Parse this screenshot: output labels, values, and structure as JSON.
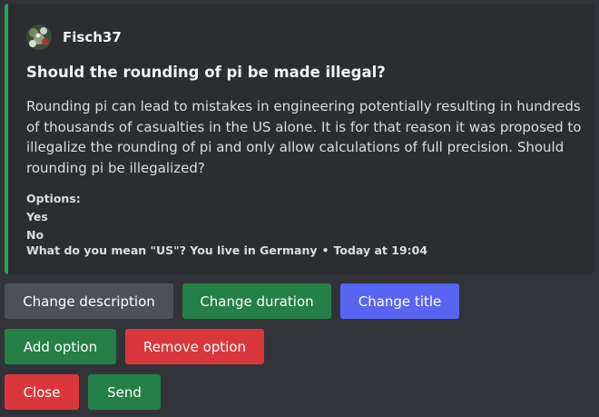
{
  "embed": {
    "accent_color": "#23a55a",
    "author": {
      "name": "Fisch37",
      "avatar_icon": "avatar-image"
    },
    "title": "Should the rounding of pi be made illegal?",
    "description": "Rounding pi can lead to mistakes in engineering potentially resulting in hundreds of thousands of casualties in the US alone. It is for that reason it was proposed to illegalize the rounding of pi and only allow calculations of full precision. Should rounding pi be illegalized?",
    "options_label": "Options:",
    "options": [
      "Yes",
      "No"
    ],
    "footer": {
      "text": "What do you mean \"US\"? You live in Germany",
      "separator": "•",
      "timestamp": "Today at 19:04"
    }
  },
  "buttons": {
    "change_description": "Change description",
    "change_duration": "Change duration",
    "change_title": "Change title",
    "add_option": "Add option",
    "remove_option": "Remove option",
    "close": "Close",
    "send": "Send"
  },
  "colors": {
    "background": "#313338",
    "embed_background": "#2b2d31",
    "grey_button": "#4e5058",
    "green_button": "#248046",
    "blurple_button": "#5865f2",
    "red_button": "#da373c"
  }
}
